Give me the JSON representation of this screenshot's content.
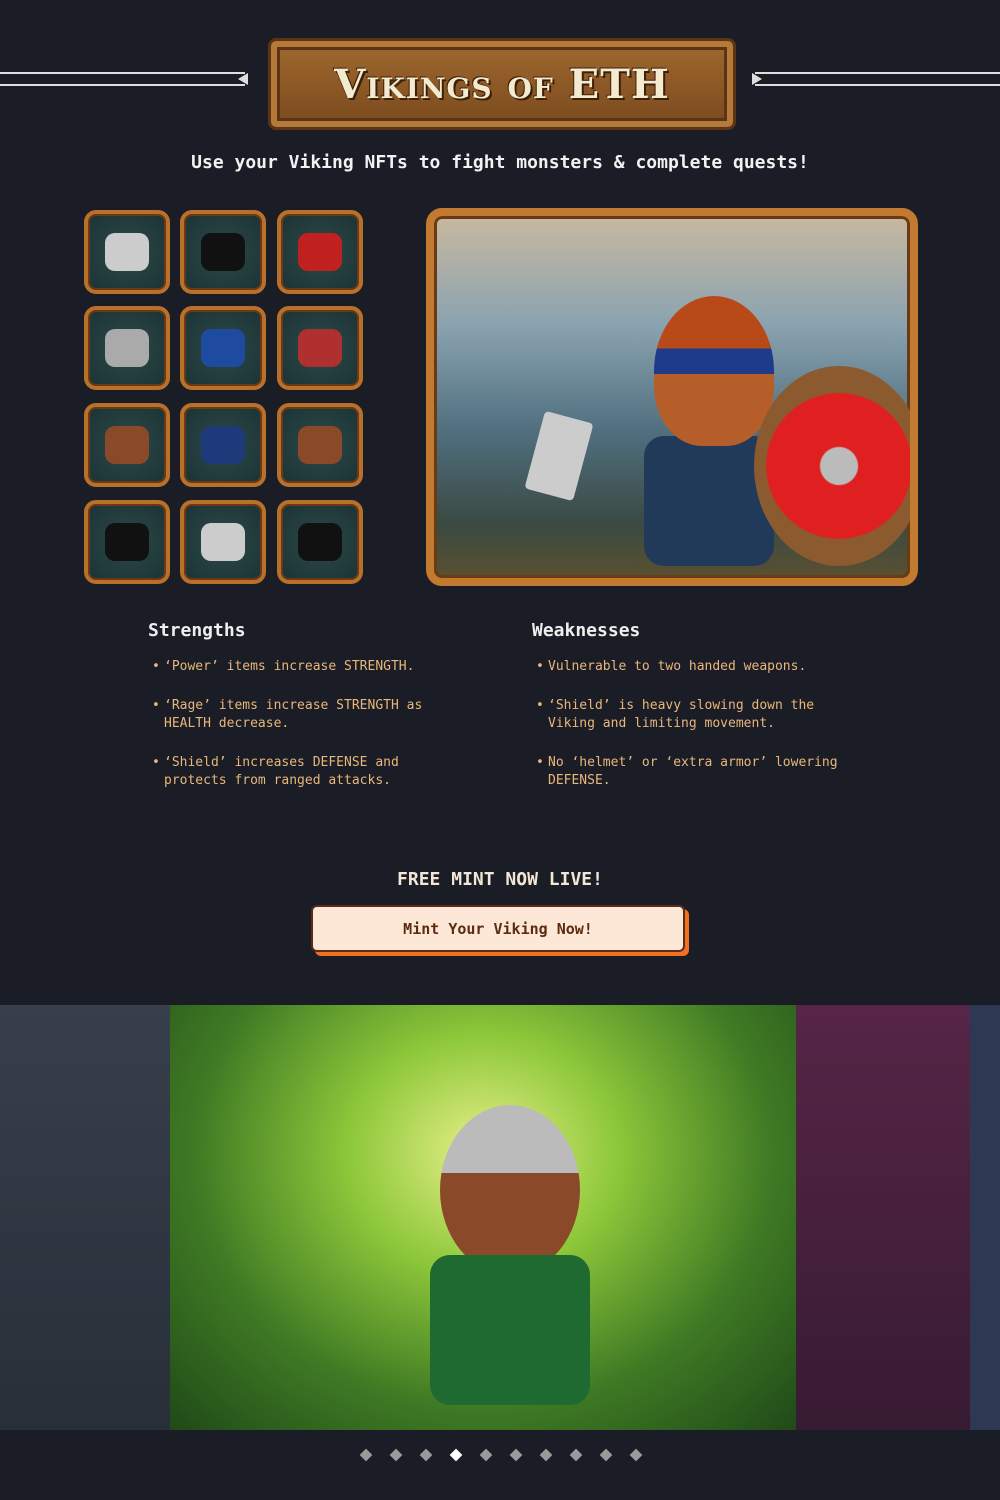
{
  "header": {
    "title": "Vikings of ETH",
    "tagline": "Use your Viking NFTs to fight monsters & complete quests!"
  },
  "items": [
    "hair-icon",
    "horned-helmet-icon",
    "red-cape-icon",
    "hammer-icon",
    "blue-shirt-icon",
    "round-shield-icon",
    "bracers-icon",
    "blue-pants-icon",
    "boots-icon",
    "black-armor-icon",
    "belt-icon",
    "black-armor-alt-icon"
  ],
  "strengths": {
    "title": "Strengths",
    "items": [
      "‘Power’ items increase STRENGTH.",
      "‘Rage’ items increase STRENGTH as HEALTH decrease.",
      "‘Shield’ increases DEFENSE and protects from ranged attacks."
    ]
  },
  "weaknesses": {
    "title": "Weaknesses",
    "items": [
      "Vulnerable to two handed weapons.",
      "‘Shield’ is heavy slowing down the Viking and limiting movement.",
      "No ‘helmet’ or ‘extra armor’ lowering DEFENSE."
    ]
  },
  "mint": {
    "headline": "FREE MINT NOW LIVE!",
    "button": "Mint Your Viking Now!"
  },
  "carousel": {
    "slide_count": 10,
    "active_index": 3
  }
}
